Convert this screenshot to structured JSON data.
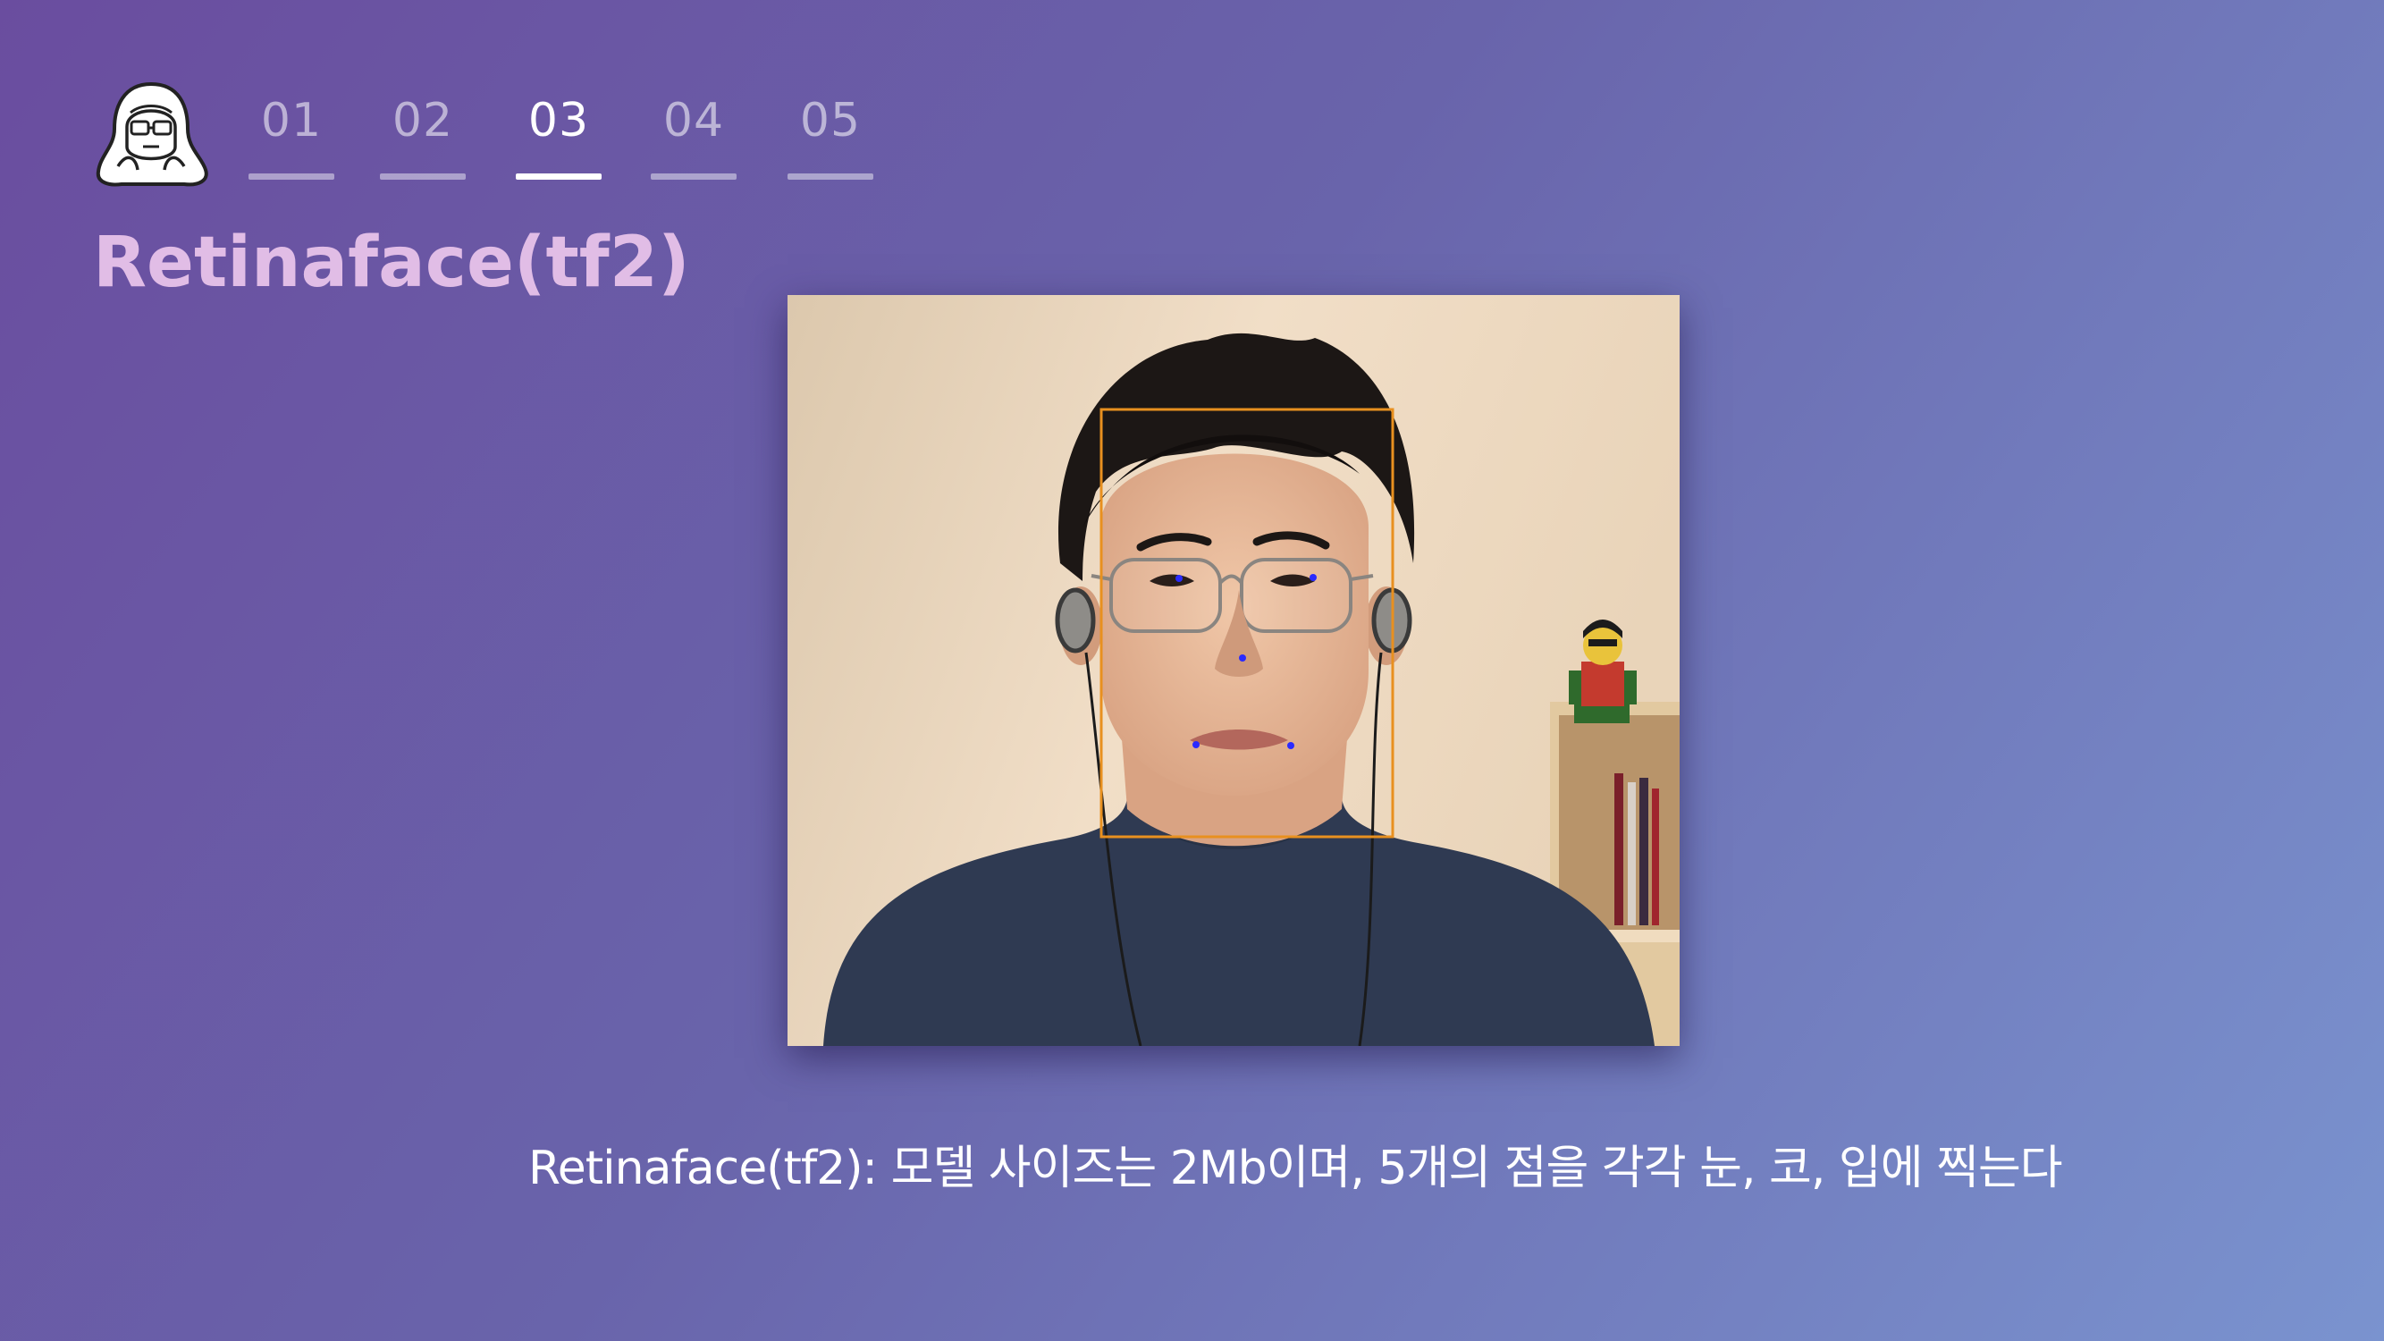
{
  "nav": {
    "logo_icon": "hooded-character-logo-icon",
    "tabs": [
      {
        "label": "01",
        "active": false
      },
      {
        "label": "02",
        "active": false
      },
      {
        "label": "03",
        "active": true
      },
      {
        "label": "04",
        "active": false
      },
      {
        "label": "05",
        "active": false
      }
    ]
  },
  "title": "Retinaface(tf2)",
  "photo": {
    "subject": "face-detection-result-photo",
    "bounding_box_color": "#e8901f",
    "landmark_color": "#2a2aff",
    "landmark_count": 5
  },
  "caption": "Retinaface(tf2): 모델 사이즈는 2Mb이며, 5개의 점을 각각 눈, 코, 입에 찍는다",
  "colors": {
    "title": "#e1bde6",
    "tab_active": "#ffffff",
    "tab_inactive": "rgba(255,255,255,0.55)"
  }
}
